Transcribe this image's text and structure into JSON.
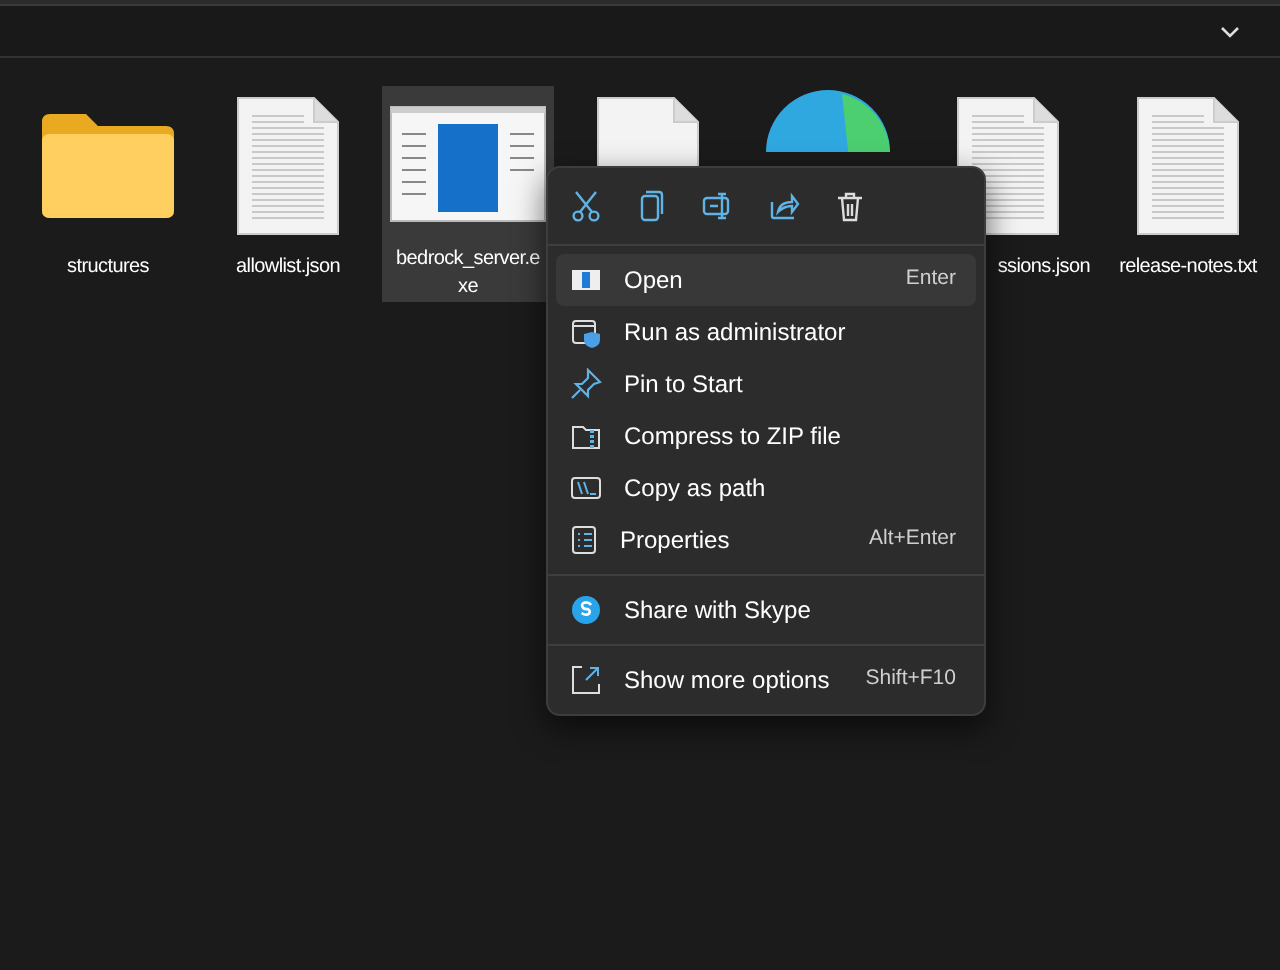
{
  "files": [
    {
      "kind": "folder",
      "label": "structures",
      "selected": false
    },
    {
      "kind": "document",
      "label": "allowlist.json",
      "selected": false
    },
    {
      "kind": "app",
      "label": "bedrock_server.exe",
      "selected": true
    },
    {
      "kind": "blank",
      "selected": false
    },
    {
      "kind": "browser",
      "selected": false
    },
    {
      "kind": "document",
      "label": "ssions.json",
      "selected": false,
      "clipped": true
    },
    {
      "kind": "document",
      "label": "release-notes.txt",
      "selected": false
    }
  ],
  "context_menu": {
    "toolbar": [
      {
        "kind": "cut"
      },
      {
        "kind": "copy"
      },
      {
        "kind": "rename"
      },
      {
        "kind": "share"
      },
      {
        "kind": "delete"
      }
    ],
    "groups": [
      [
        {
          "label": "Open",
          "shortcut": "Enter",
          "selected": true
        },
        {
          "label": "Run as administrator",
          "selected": false
        },
        {
          "label": "Pin to Start",
          "selected": false
        },
        {
          "label": "Compress to ZIP file",
          "selected": false
        },
        {
          "label": "Copy as path",
          "selected": false
        },
        {
          "label": "Properties",
          "shortcut": "Alt+Enter",
          "selected": false
        }
      ],
      [
        {
          "label": "Share with Skype",
          "selected": false
        }
      ],
      [
        {
          "label": "Show more options",
          "shortcut": "Shift+F10",
          "selected": false
        }
      ]
    ]
  }
}
